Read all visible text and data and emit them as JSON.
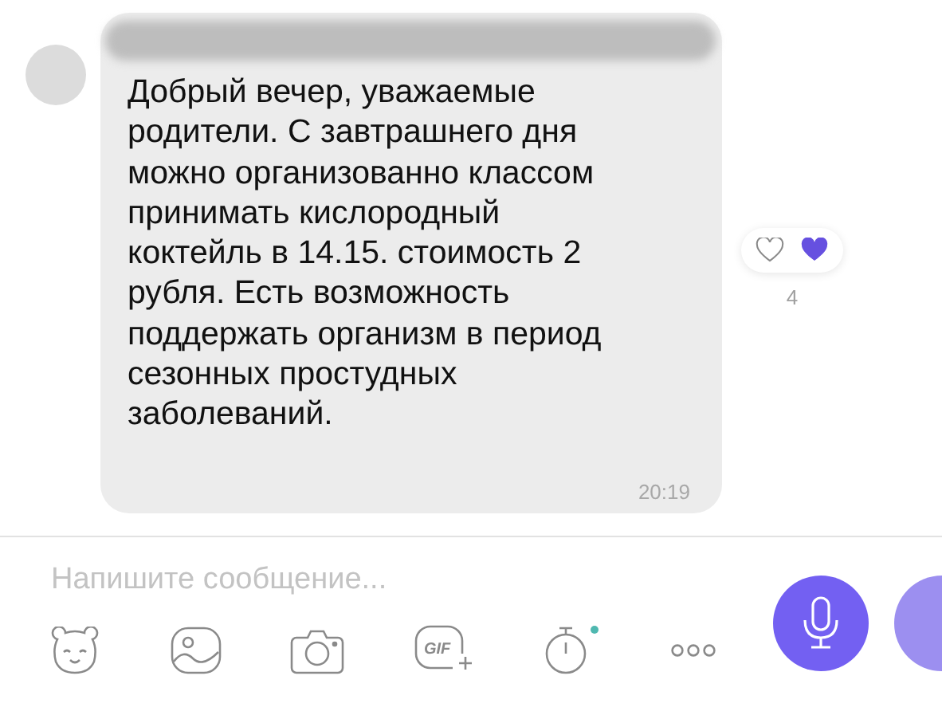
{
  "message": {
    "text": "Добрый вечер, уважаемые\nродители. С завтрашнего дня\nможно организованно классом\nпринимать кислородный\nкоктейль в 14.15. стоимость 2\nрубля. Есть возможность\nподдержать организм в период\nсезонных простудных\nзаболеваний.",
    "time": "20:19",
    "reaction_count": "4"
  },
  "composer": {
    "placeholder": "Напишите сообщение...",
    "gif_label": "GIF"
  }
}
